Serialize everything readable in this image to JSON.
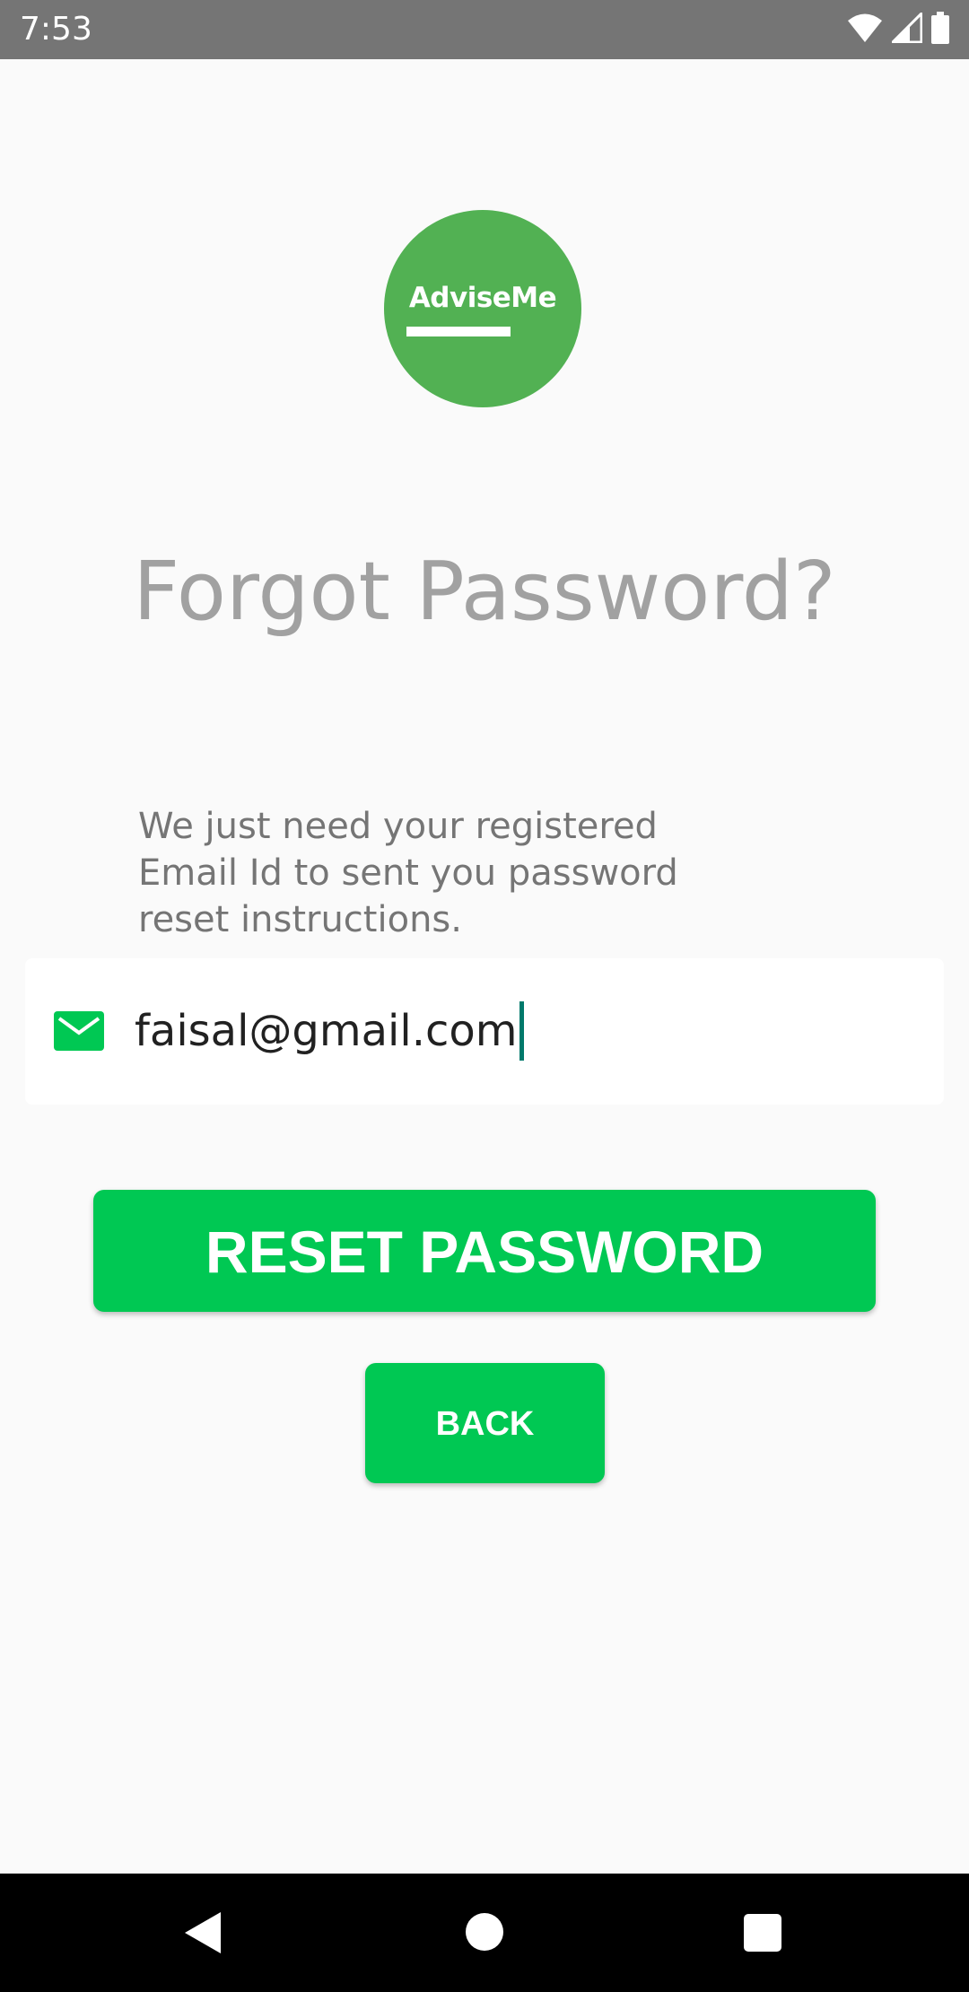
{
  "status_bar": {
    "time": "7:53",
    "icons": [
      "wifi-icon",
      "signal-icon",
      "battery-icon"
    ]
  },
  "logo": {
    "text": "AdviseMe",
    "color": "#52b153"
  },
  "title": "Forgot Password?",
  "description": "We just need your registered Email Id to sent you password reset instructions.",
  "email_field": {
    "icon": "email-icon",
    "value": "faisal@gmail.com"
  },
  "buttons": {
    "reset_label": "RESET PASSWORD",
    "back_label": "BACK"
  },
  "nav_bar": {
    "icons": [
      "nav-back-icon",
      "nav-home-icon",
      "nav-recents-icon"
    ]
  },
  "colors": {
    "accent": "#00c853",
    "caret": "#00796b",
    "status_bar": "#757575",
    "background": "#fafafa"
  }
}
